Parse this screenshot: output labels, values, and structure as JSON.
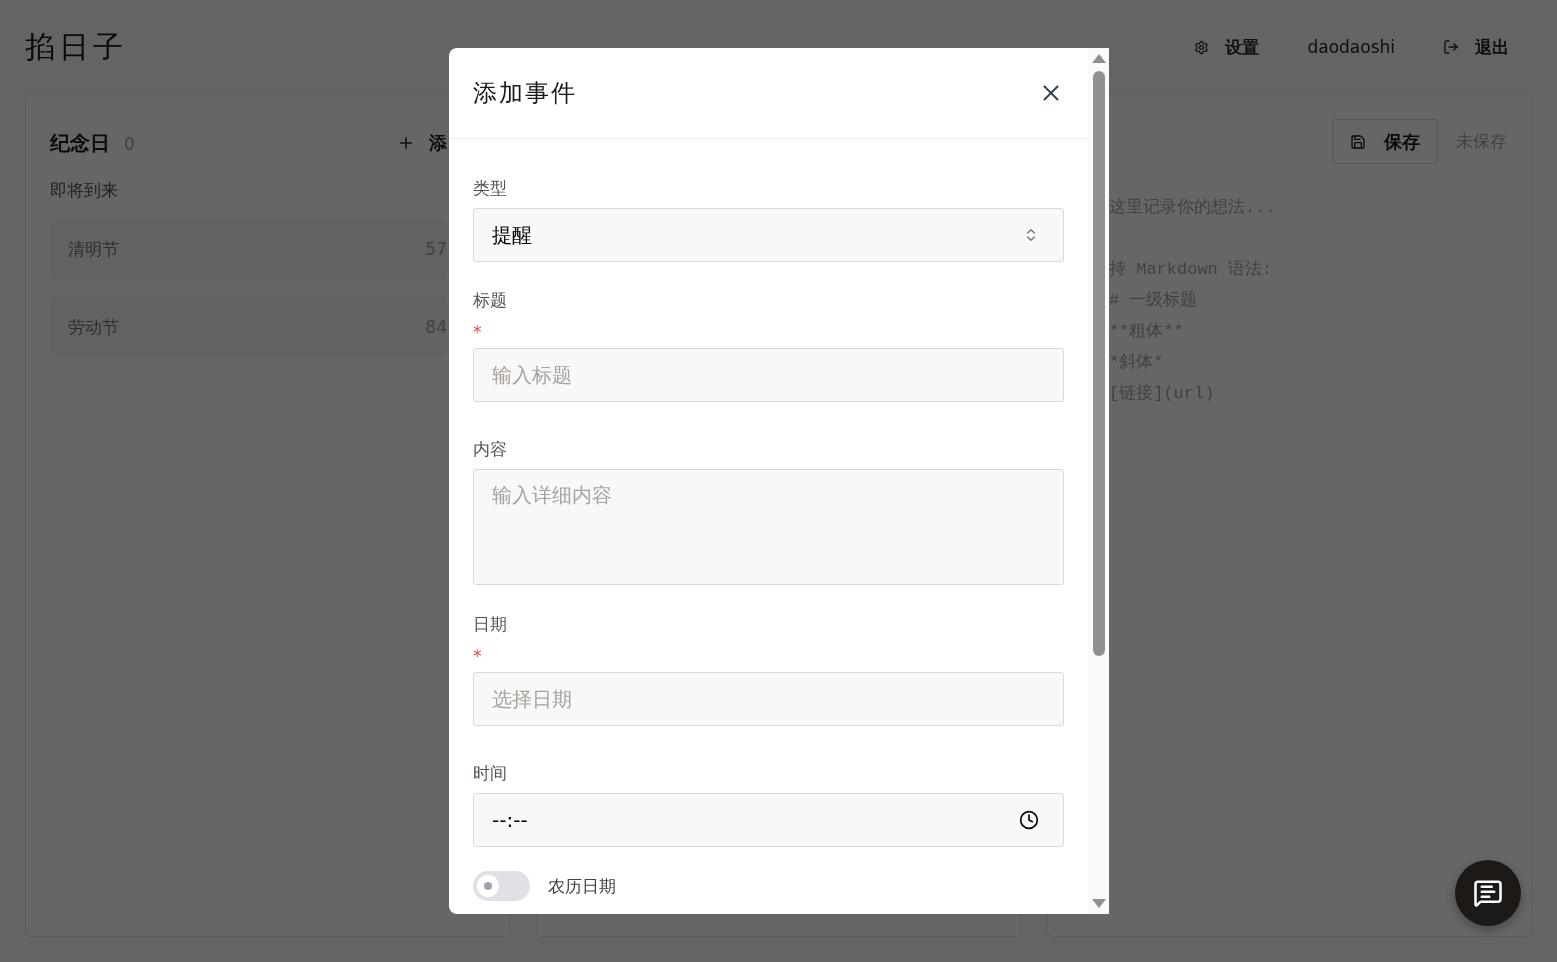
{
  "app": {
    "title": "掐日子"
  },
  "nav": [
    {
      "kind": "settings",
      "label": "设置"
    },
    {
      "kind": "user",
      "label": "daodaoshi"
    },
    {
      "kind": "logout",
      "label": "退出"
    }
  ],
  "anniversary_panel": {
    "title": "纪念日",
    "count": "0",
    "add_label": "添",
    "section": "即将到来",
    "items": [
      {
        "name": "清明节",
        "days": "57"
      },
      {
        "name": "劳动节",
        "days": "84"
      }
    ]
  },
  "notes_panel": {
    "save_label": "保存",
    "status": "未保存",
    "placeholder": "这里记录你的想法...\n\n持 Markdown 语法:\n# 一级标题\n**粗体**\n*斜体*\n[链接](url)"
  },
  "dialog": {
    "title": "添加事件",
    "required_mark": "*",
    "fields": [
      {
        "kind": "select",
        "label": "类型",
        "value": "提醒",
        "required": false
      },
      {
        "kind": "text",
        "label": "标题",
        "placeholder": "输入标题",
        "required": true
      },
      {
        "kind": "textarea",
        "label": "内容",
        "placeholder": "输入详细内容",
        "required": false
      },
      {
        "kind": "text",
        "label": "日期",
        "placeholder": "选择日期",
        "required": true
      },
      {
        "kind": "time",
        "label": "时间",
        "value": "--:--",
        "required": false
      },
      {
        "kind": "toggle",
        "label": "农历日期",
        "on": false
      }
    ]
  }
}
